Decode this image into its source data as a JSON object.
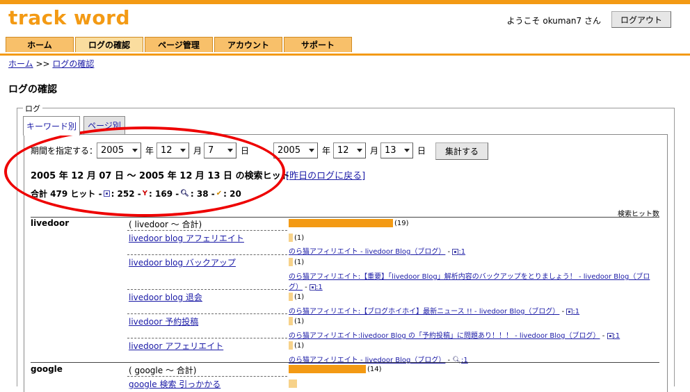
{
  "app": {
    "logo": "track word",
    "welcome": "ようこそ okuman7 さん",
    "logout_label": "ログアウト"
  },
  "nav": {
    "tabs": [
      "ホーム",
      "ログの確認",
      "ページ管理",
      "アカウント",
      "サポート"
    ],
    "active": 1
  },
  "breadcrumb": {
    "home": "ホーム",
    "sep": ">>",
    "current": "ログの確認"
  },
  "page_title": "ログの確認",
  "legend": "ログ",
  "subtabs": [
    "キーワード別",
    "ページ別"
  ],
  "period": {
    "label": "期間を指定する：",
    "from": {
      "year": "2005",
      "month": "12",
      "day": "7"
    },
    "to": {
      "year": "2005",
      "month": "12",
      "day": "13"
    },
    "unit_year": "年",
    "unit_month": "月",
    "unit_day": "日",
    "submit_label": "集計する"
  },
  "range_text": "2005 年 12 月 07 日 ～ 2005 年 12 月 13 日 の検索ヒット",
  "yesterday_link": "[昨日のログに戻る]",
  "totals": {
    "prefix": "合計 479 ヒット - ",
    "g": ": 252 - ",
    "y": ": 169 - ",
    "s": ": 38 - ",
    "m": ": 20"
  },
  "hits_label": "検索ヒット数",
  "colors": {
    "accent": "#f39a14",
    "link": "#1a1aa6",
    "annotation": "#e00000"
  },
  "livedoor": {
    "engine": "livedoor",
    "total_label": "( livedoor ～ 合計)",
    "total_count": "(19)",
    "rows": [
      {
        "kw": "livedoor blog アフェリエイト",
        "count": "(1)",
        "src": "のら猫アフィリエイト - livedoor Blog（ブログ）",
        "tail": " - ",
        "tailval": ":1"
      },
      {
        "kw": "livedoor blog バックアップ",
        "count": "(1)",
        "src": "のら猫アフィリエイト:【重要】「livedoor Blog」解析内容のバックアップをとりましょう！ - livedoor Blog（ブロ",
        "src2": "グ）",
        "tail": " - ",
        "tailval": ":1"
      },
      {
        "kw": "livedoor blog 退会",
        "count": "(1)",
        "src": "のら猫アフィリエイト:【ブログホイホイ】最新ニュース !! - livedoor Blog（ブログ）",
        "tail": " - ",
        "tailval": ":1"
      },
      {
        "kw": "livedoor 予約投稿",
        "count": "(1)",
        "src": "のら猫アフィリエイト:livedoor Blog の「予約投稿」に問題あり！！！ - livedoor Blog（ブログ）",
        "tail": " - ",
        "tailval": ":1"
      },
      {
        "kw": "livedoor アフェリエイト",
        "count": "(1)",
        "src": "のら猫アフィリエイト - livedoor Blog（ブログ）",
        "tail": " - ",
        "tailval": ":1"
      }
    ]
  },
  "google": {
    "engine": "google",
    "total_label": "( google ～ 合計)",
    "total_count": "(14)",
    "partial_kw": "google 検索 引っかかる",
    "partial_count": "(2)"
  },
  "bar_data": {
    "max": 19,
    "livedoor_total": 19,
    "google_total": 14,
    "livedoor_rows": [
      1,
      1,
      1,
      1,
      1
    ]
  }
}
